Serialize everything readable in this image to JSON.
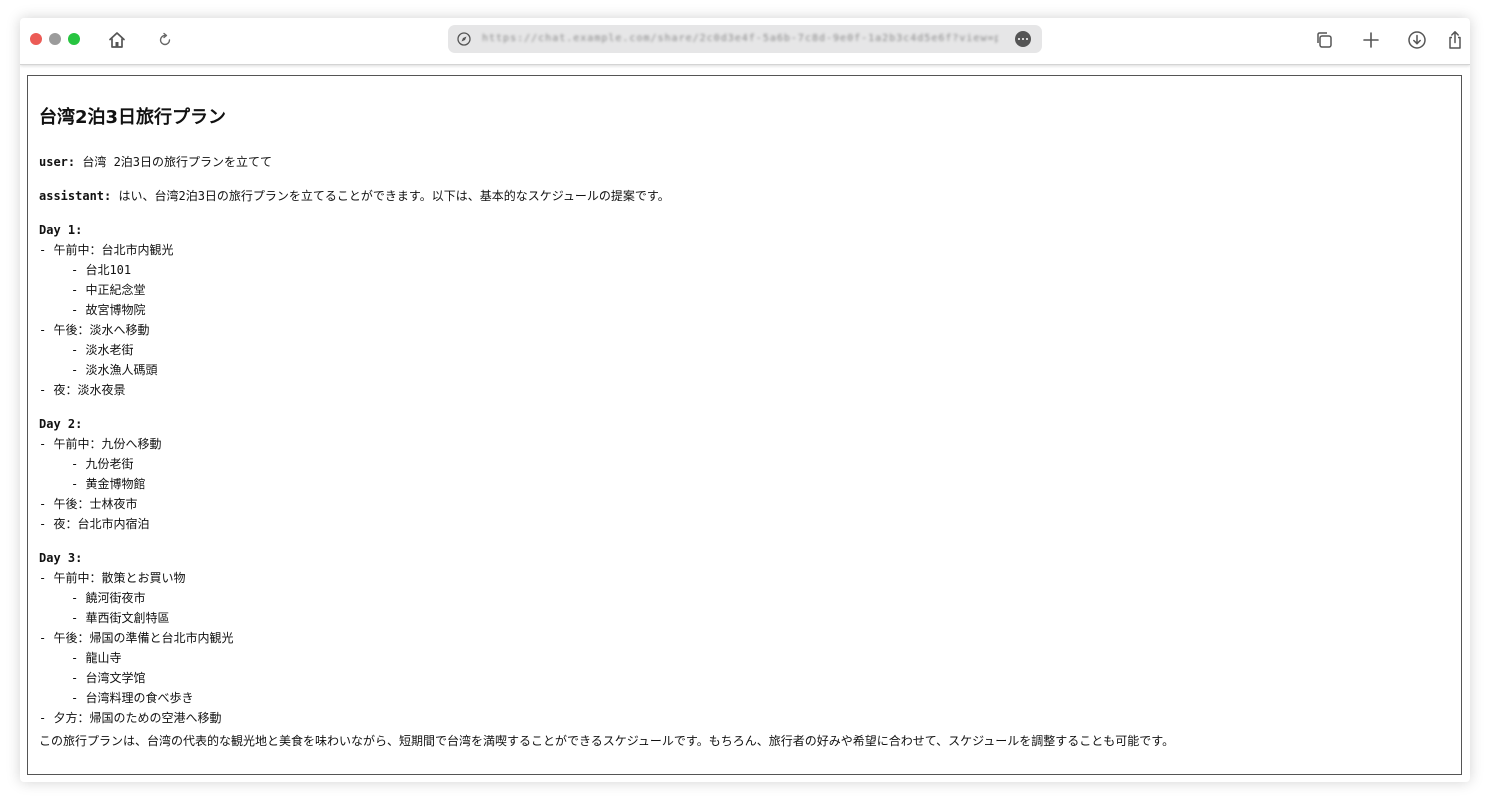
{
  "browser": {
    "url": "https://chat.example.com/share/2c0d3e4f-5a6b-7c8d-9e0f-1a2b3c4d5e6f?view=print",
    "colors": {
      "close": "#ec5b56",
      "minimize": "#9b9b9b",
      "maximize": "#27c440"
    },
    "icons": [
      "home-icon",
      "reload-icon",
      "site-info-icon",
      "more-icon",
      "tabs-icon",
      "new-tab-icon",
      "download-icon",
      "share-icon"
    ]
  },
  "page": {
    "title": "台湾2泊3日旅行プラン",
    "user_role": "user:",
    "user_message": "台湾 2泊3日の旅行プランを立てて",
    "assistant_role": "assistant:",
    "assistant_intro": "はい、台湾2泊3日の旅行プランを立てることができます。以下は、基本的なスケジュールの提案です。",
    "days": [
      {
        "label": "Day 1:",
        "items": [
          {
            "text": "- 午前中：台北市内観光",
            "subs": [
              "- 台北101",
              "- 中正紀念堂",
              "- 故宮博物院"
            ]
          },
          {
            "text": "- 午後：淡水へ移動",
            "subs": [
              "- 淡水老街",
              "- 淡水漁人碼頭"
            ]
          },
          {
            "text": "- 夜：淡水夜景",
            "subs": []
          }
        ]
      },
      {
        "label": "Day 2:",
        "items": [
          {
            "text": "- 午前中：九份へ移動",
            "subs": [
              "- 九份老街",
              "- 黄金博物館"
            ]
          },
          {
            "text": "- 午後：士林夜市",
            "subs": []
          },
          {
            "text": "- 夜：台北市内宿泊",
            "subs": []
          }
        ]
      },
      {
        "label": "Day 3:",
        "items": [
          {
            "text": "- 午前中：散策とお買い物",
            "subs": [
              "- 饒河街夜市",
              "- 華西街文創特區"
            ]
          },
          {
            "text": "- 午後：帰国の準備と台北市内観光",
            "subs": [
              "- 龍山寺",
              "- 台湾文学馆",
              "- 台湾料理の食べ歩き"
            ]
          },
          {
            "text": "- 夕方：帰国のための空港へ移動",
            "subs": []
          }
        ]
      }
    ],
    "closing": "この旅行プランは、台湾の代表的な観光地と美食を味わいながら、短期間で台湾を満喫することができるスケジュールです。もちろん、旅行者の好みや希望に合わせて、スケジュールを調整することも可能です。"
  }
}
